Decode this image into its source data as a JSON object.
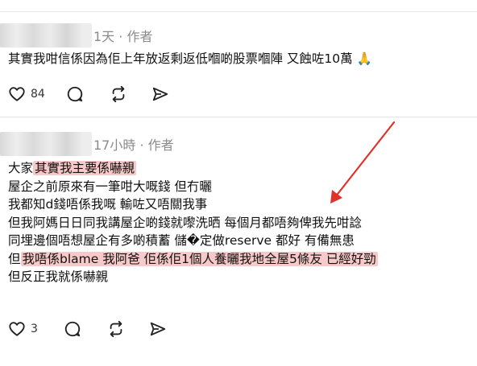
{
  "posts": [
    {
      "time": "1天",
      "author_tag": "作者",
      "lines": [
        {
          "segments": [
            {
              "text": "其實我咁信係因為佢上年放返剩返低嗰啲股票嗰陣 又蝕咗10萬 🙏",
              "highlight": false
            }
          ]
        }
      ],
      "likes": "84"
    },
    {
      "time": "17小時",
      "author_tag": "作者",
      "lines": [
        {
          "segments": [
            {
              "text": "大家",
              "highlight": false
            },
            {
              "text": "其實我主要係嚇親",
              "highlight": true
            }
          ]
        },
        {
          "segments": [
            {
              "text": "屋企之前原來有一筆咁大嘅錢 但冇曬",
              "highlight": false
            }
          ]
        },
        {
          "segments": [
            {
              "text": "我都知d錢唔係我嘅 輸咗又唔關我事",
              "highlight": false
            }
          ]
        },
        {
          "segments": [
            {
              "text": "但我阿媽日日同我講屋企啲錢就嚟洗晒 每個月都唔夠俾我先咁諗",
              "highlight": false
            }
          ]
        },
        {
          "segments": [
            {
              "text": "同埋邊個唔想屋企有多啲積蓄 儲&#xFFFD;定做reserve 都好 有備無患",
              "highlight": false
            }
          ]
        },
        {
          "segments": [
            {
              "text": "但",
              "highlight": false
            },
            {
              "text": "我唔係blame 我阿爸 佢係佢1個人養曬我地全屋5條友 已經好勁",
              "highlight": true
            }
          ]
        },
        {
          "segments": [
            {
              "text": "但反正我就係嚇親",
              "highlight": false
            }
          ]
        }
      ],
      "likes": "3"
    }
  ],
  "meta_separator": "·",
  "icons": {
    "like": "heart-icon",
    "comment": "comment-bubble-icon",
    "repost": "repost-icon",
    "share": "send-icon",
    "annotation": "red-arrow"
  },
  "colors": {
    "highlight": "#f7c9c9",
    "arrow": "#e0312a",
    "meta_text": "#8a8a8a"
  }
}
